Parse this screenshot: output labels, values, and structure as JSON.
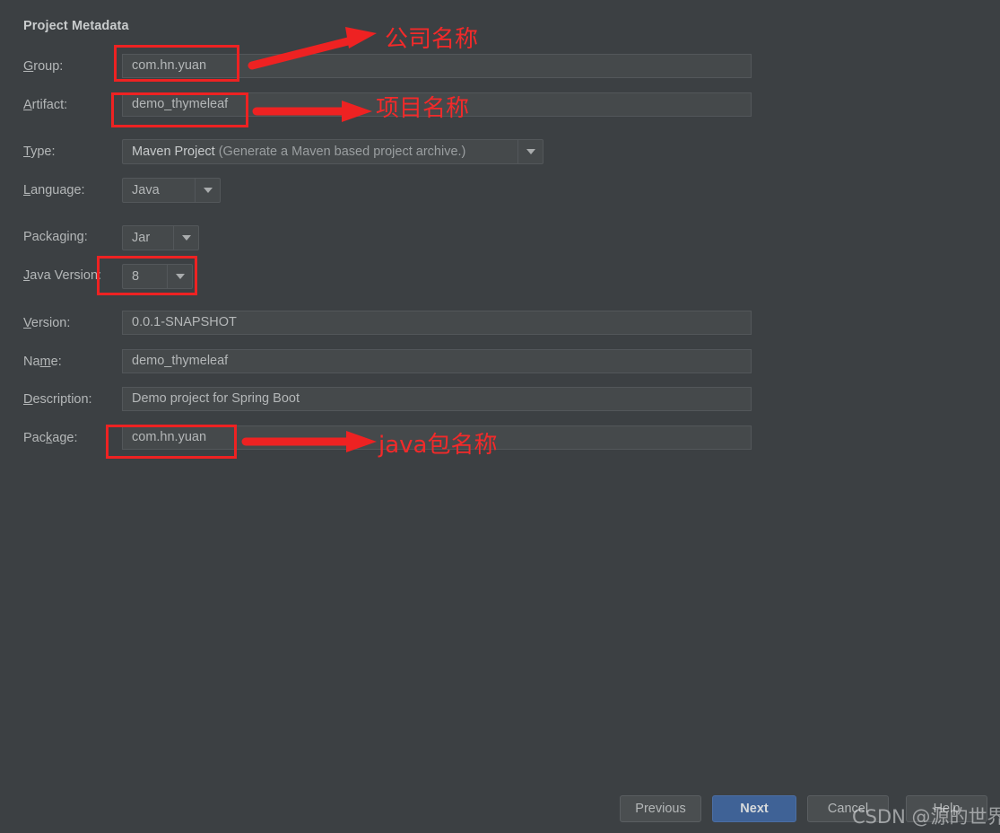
{
  "dialog": {
    "section_title": "Project Metadata"
  },
  "fields": {
    "group": {
      "label": "Group:",
      "mnemonic": "G",
      "rest": "roup:",
      "value": "com.hn.yuan"
    },
    "artifact": {
      "label": "Artifact:",
      "mnemonic": "A",
      "rest": "rtifact:",
      "value": "demo_thymeleaf"
    },
    "type": {
      "label": "Type:",
      "mnemonic": "T",
      "rest": "ype:",
      "value_primary": "Maven Project",
      "value_secondary": "(Generate a Maven based project archive.)"
    },
    "language": {
      "label": "Language:",
      "mnemonic": "L",
      "rest": "anguage:",
      "value": "Java"
    },
    "packaging": {
      "label_pre": "Packa",
      "mnemonic": "g",
      "label_post": "ing:",
      "value": "Jar"
    },
    "java_version": {
      "mnemonic": "J",
      "label_post": "ava Version:",
      "value": "8"
    },
    "version": {
      "mnemonic": "V",
      "label_post": "ersion:",
      "value": "0.0.1-SNAPSHOT"
    },
    "name": {
      "label_pre": "Na",
      "mnemonic": "m",
      "label_post": "e:",
      "value": "demo_thymeleaf"
    },
    "description": {
      "mnemonic": "D",
      "label_post": "escription:",
      "value": "Demo project for Spring Boot"
    },
    "package": {
      "label_pre": "Pac",
      "mnemonic": "k",
      "label_post": "age:",
      "value": "com.hn.yuan"
    }
  },
  "annotations": {
    "company_name": "公司名称",
    "project_name": "项目名称",
    "java_package_name": "java包名称",
    "highlight_color": "#ee2222"
  },
  "buttons": {
    "previous": "Previous",
    "next": "Next",
    "cancel": "Cancel",
    "help": "Help",
    "next_color": "#3f6296"
  },
  "watermark": {
    "text": "CSDN @源的世界"
  }
}
